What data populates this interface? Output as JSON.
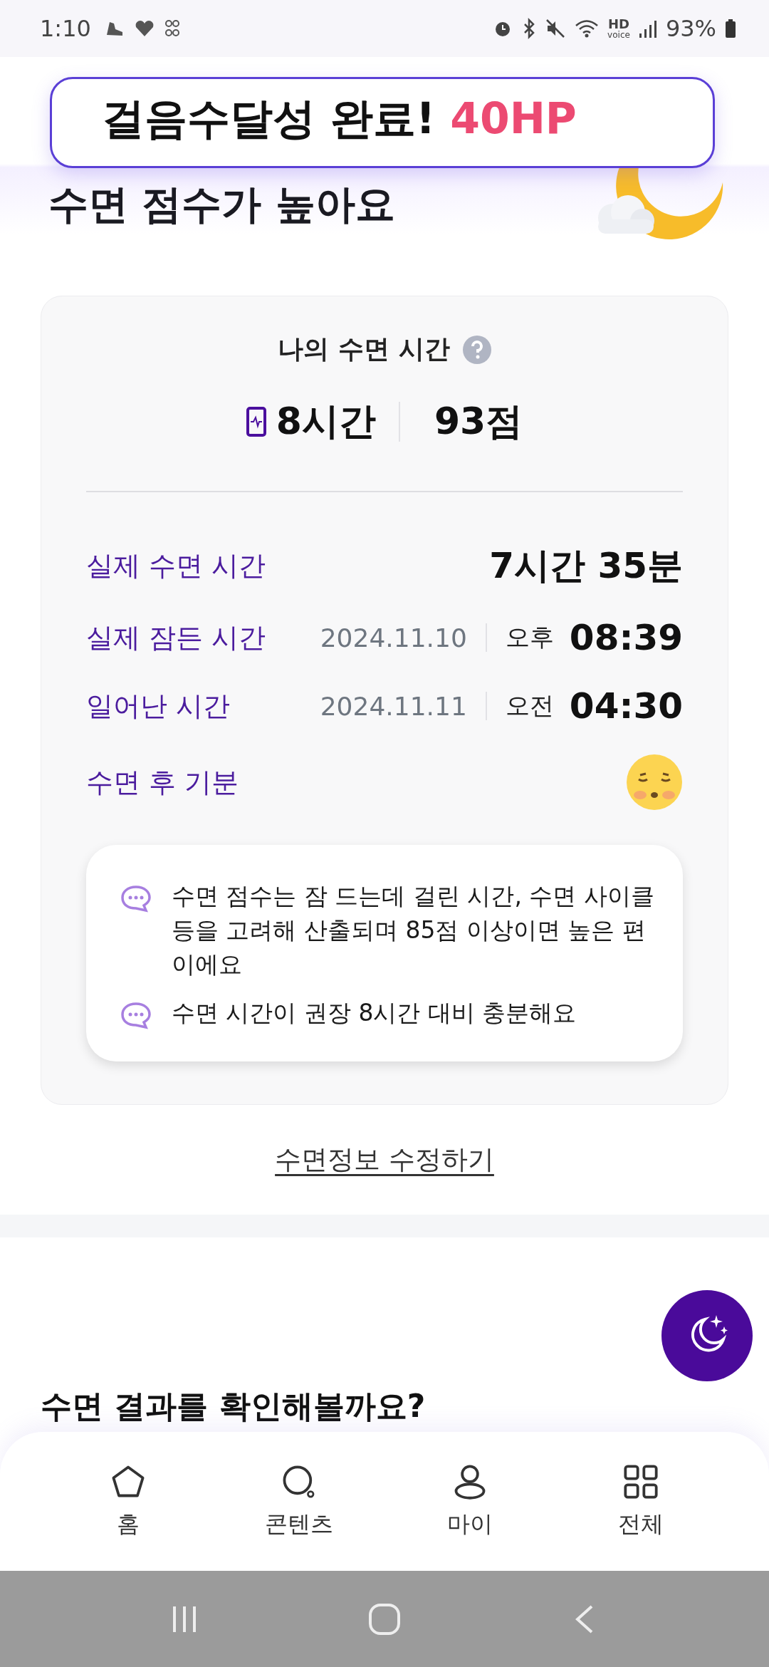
{
  "status_bar": {
    "time": "1:10",
    "network_label": "HD",
    "network_sublabel": "voice",
    "battery": "93%"
  },
  "toast": {
    "text": "걸음수달성 완료!",
    "highlight": "40HP"
  },
  "header": {
    "title": "수면 점수가 높아요"
  },
  "sleep_card": {
    "title": "나의 수면 시간",
    "duration": "8시간",
    "score": "93점",
    "details": [
      {
        "kind": "duration",
        "label": "실제 수면 시간",
        "value": "7시간 35분"
      },
      {
        "kind": "time",
        "label": "실제 잠든 시간",
        "date": "2024.11.10",
        "period": "오후",
        "time": "08:39"
      },
      {
        "kind": "time",
        "label": "일어난 시간",
        "date": "2024.11.11",
        "period": "오전",
        "time": "04:30"
      },
      {
        "kind": "mood",
        "label": "수면 후 기분"
      }
    ],
    "messages": [
      "수면 점수는 잠 드는데 걸린 시간, 수면 사이클 등을 고려해 산출되며 85점 이상이면 높은 편이에요",
      "수면 시간이 권장 8시간 대비 충분해요"
    ]
  },
  "edit_link": "수면정보 수정하기",
  "results": {
    "heading": "수면 결과를 확인해볼까요?"
  },
  "bottom_nav": [
    {
      "kind": "home",
      "label": "홈"
    },
    {
      "kind": "content",
      "label": "콘텐츠"
    },
    {
      "kind": "my",
      "label": "마이"
    },
    {
      "kind": "all",
      "label": "전체"
    }
  ]
}
